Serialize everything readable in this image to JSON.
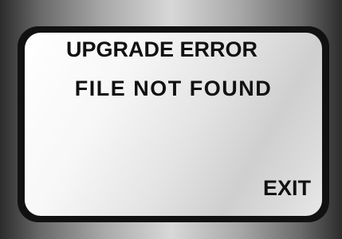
{
  "screen": {
    "title": "UPGRADE ERROR",
    "message": "FILE NOT FOUND",
    "exit_label": "EXIT"
  }
}
